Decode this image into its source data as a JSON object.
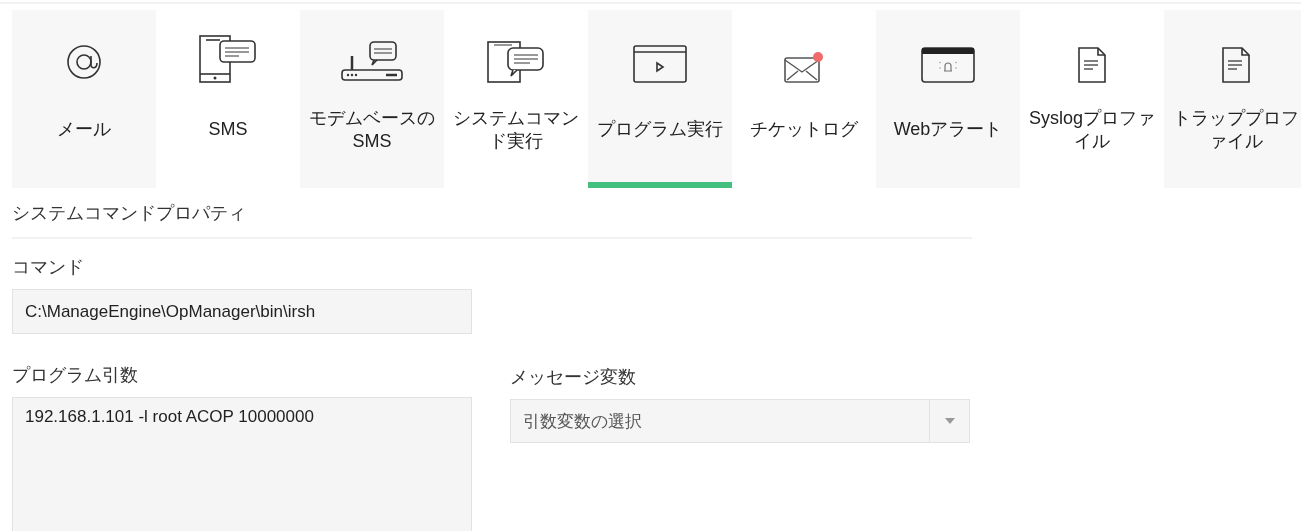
{
  "tabs": [
    {
      "kind": "email",
      "label": "メール",
      "selected": false
    },
    {
      "kind": "sms",
      "label": "SMS",
      "selected": false
    },
    {
      "kind": "modem",
      "label": "モデムベースのSMS",
      "selected": false
    },
    {
      "kind": "command",
      "label": "システムコマンド実行",
      "selected": false
    },
    {
      "kind": "program",
      "label": "プログラム実行",
      "selected": true
    },
    {
      "kind": "ticket",
      "label": "チケットログ",
      "selected": false
    },
    {
      "kind": "webalert",
      "label": "Webアラート",
      "selected": false
    },
    {
      "kind": "document",
      "label": "Syslogプロファイル",
      "selected": false
    },
    {
      "kind": "document",
      "label": "トラッププロファイル",
      "selected": false
    }
  ],
  "section_title": "システムコマンドプロパティ",
  "command": {
    "label": "コマンド",
    "value": "C:\\ManageEngine\\OpManager\\bin\\irsh"
  },
  "program_arguments": {
    "label": "プログラム引数",
    "value": "192.168.1.101 -l root ACOP 10000000"
  },
  "message_variables": {
    "label": "メッセージ変数",
    "value": "引数変数の選択"
  }
}
